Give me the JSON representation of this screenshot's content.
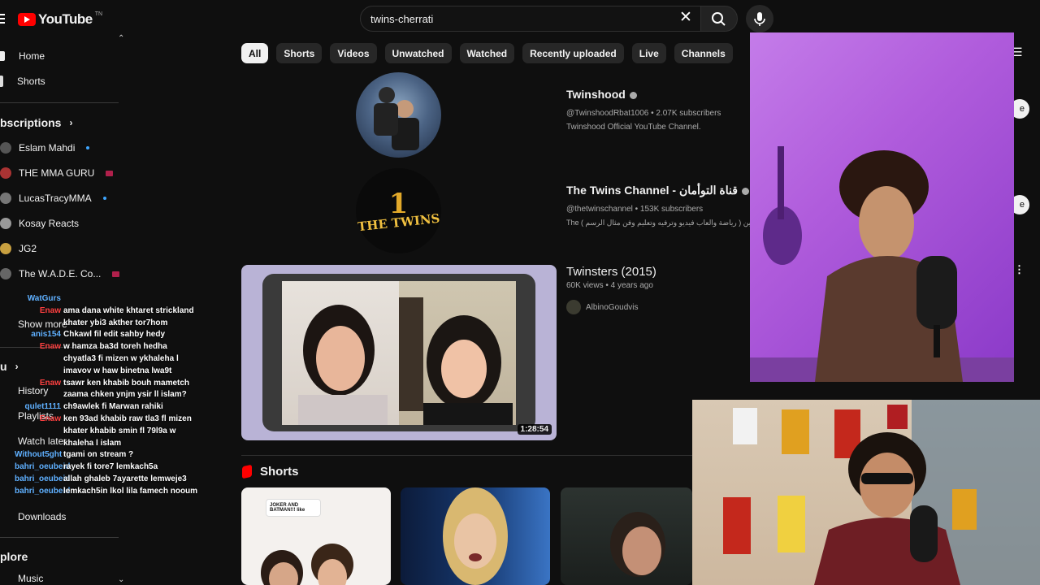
{
  "header": {
    "logo_text": "YouTube",
    "logo_tn": "TN",
    "search_value": "twins-cherrati"
  },
  "chips": [
    "All",
    "Shorts",
    "Videos",
    "Unwatched",
    "Watched",
    "Recently uploaded",
    "Live",
    "Channels"
  ],
  "sidebar": {
    "home": "Home",
    "shorts": "Shorts",
    "subscriptions_header": "bscriptions",
    "subscriptions": [
      {
        "label": "Eslam Mahdi",
        "status": "new"
      },
      {
        "label": "THE MMA GURU",
        "status": "live"
      },
      {
        "label": "LucasTracyMMA",
        "status": "new"
      },
      {
        "label": "Kosay Reacts",
        "status": ""
      },
      {
        "label": "JG2",
        "status": ""
      },
      {
        "label": "The W.A.D.E. Co...",
        "status": "live"
      }
    ],
    "show_more": "Show more",
    "you_header": "u",
    "history": "History",
    "playlists": "Playlists",
    "watch_later": "Watch later",
    "downloads": "Downloads",
    "explore_header": "plore",
    "music": "Music"
  },
  "chat": [
    {
      "user": "WatGurs",
      "msg": "",
      "color": "#5fb0ff"
    },
    {
      "user": "Enaw",
      "msg": "ama dana white khtaret strickland",
      "color": "#ff4040"
    },
    {
      "user": "",
      "msg": "khater ybi3 akther tor7hom",
      "color": "#ff4040"
    },
    {
      "user": "anis154",
      "msg": "Chkawl fil edit sahby hedy",
      "color": "#5fb0ff"
    },
    {
      "user": "Enaw",
      "msg": "w hamza ba3d toreh hedha",
      "color": "#ff4040"
    },
    {
      "user": "",
      "msg": "chyatla3 fi mizen w ykhaleha l",
      "color": "#ff4040"
    },
    {
      "user": "",
      "msg": "imavov w haw binetna lwa9t",
      "color": "#ff4040"
    },
    {
      "user": "Enaw",
      "msg": "tsawr ken khabib bouh mametch",
      "color": "#ff4040"
    },
    {
      "user": "",
      "msg": "zaama chken ynjm ysir ll islam?",
      "color": "#ff4040"
    },
    {
      "user": "qulet1111",
      "msg": "ch9awlek fi Marwan rahiki",
      "color": "#5fb0ff"
    },
    {
      "user": "Enaw",
      "msg": "ken 93ad khabib raw tla3 fl mizen",
      "color": "#ff4040"
    },
    {
      "user": "",
      "msg": "khater khabib smin fl 79l9a w",
      "color": "#ff4040"
    },
    {
      "user": "",
      "msg": "khaleha l islam",
      "color": "#ff4040"
    },
    {
      "user": "Without5ght",
      "msg": "tgami on stream ?",
      "color": "#5fb0ff"
    },
    {
      "user": "bahri_oeubeid",
      "msg": "rayek fi tore7 lemkach5a",
      "color": "#5fb0ff"
    },
    {
      "user": "bahri_oeubeid",
      "msg": "allah ghaleb 7ayarette lemweje3",
      "color": "#5fb0ff"
    },
    {
      "user": "bahri_oeubeid",
      "msg": "lemkach5in lkol lila famech nooum",
      "color": "#5fb0ff"
    }
  ],
  "results": {
    "ch1": {
      "name": "Twinshood",
      "meta": "@TwinshoodRbat1006 • 2.07K subscribers",
      "desc": "Twinshood Official YouTube Channel."
    },
    "ch2": {
      "name": "The Twins Channel - قناة التوأمان",
      "meta": "@thetwinschannel • 153K subscribers",
      "desc": "The ( رياضة والعاب فيديو وترفيه وتعليم وفن مثال الرسم ) جميع المشاهدين",
      "logo_line1": "THE TWINS",
      "logo_num": "1"
    },
    "video": {
      "title": "Twinsters (2015)",
      "meta": "60K views • 4 years ago",
      "channel": "AlbinoGoudvis",
      "duration": "1:28:54"
    },
    "shorts_title": "Shorts",
    "short1_caption": "JOKER AND BATMAN!!! like"
  }
}
